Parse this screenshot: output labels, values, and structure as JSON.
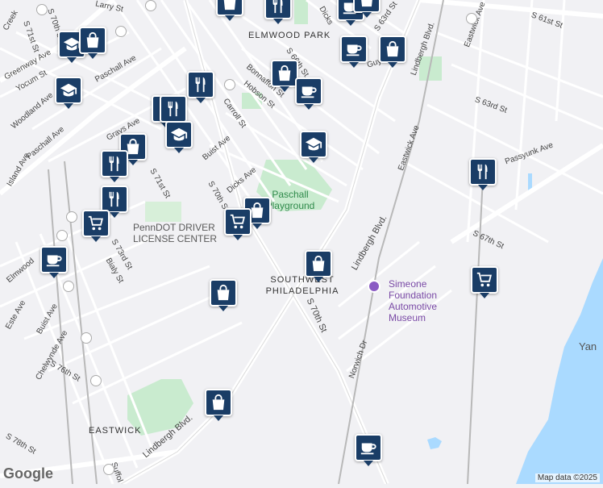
{
  "map": {
    "neighborhoods": [
      "ELMWOOD PARK",
      "SOUTHWEST PHILADELPHIA",
      "EASTWICK"
    ],
    "water_label": "Yan",
    "parks": [
      "Paschall Playground"
    ],
    "pois": [
      "PennDOT DRIVER LICENSE CENTER",
      "Simeone Foundation Automotive Museum"
    ],
    "streets": {
      "larry": "Larry St",
      "s70a": "S 70th St",
      "s71a": "S 71st St",
      "creek": "Creek",
      "greenway": "Greenway Ave",
      "yocum": "Yocum St",
      "paschall1": "Paschall Ave",
      "woodland": "Woodland Ave",
      "paschall2": "Paschall Ave",
      "island": "Island Ave",
      "grays": "Grays Ave",
      "bonnaffon": "Bonnaffon St",
      "hobson": "Hobson St",
      "carroll": "Carroll St",
      "buist1": "Buist Ave",
      "dicks1": "Dicks Ave",
      "s70b": "S 70th St",
      "s71b": "S 71st St",
      "s66": "S 66th St",
      "s63a": "S 63rd St",
      "s61": "S 61st St",
      "eastwick1": "Eastwick Ave",
      "eastwick2": "Eastwick Ave",
      "s63b": "S 63rd St",
      "lindbergh1": "Lindbergh Blvd.",
      "lindbergh2": "Lindbergh Blvd.",
      "lindbergh3": "Lindbergh Blvd.",
      "passyunk": "Passyunk Ave",
      "s67": "S 67th St",
      "s73": "S 73rd St",
      "bialy": "Bialy St",
      "elmwood": "Elmwood",
      "este": "Este Ave",
      "buist2": "Buist Ave",
      "chelwynde": "Chelwynde Ave",
      "s76": "S 76th St",
      "s70c": "S 70th St",
      "norwich": "Norwich Dr",
      "s78": "S 78th St",
      "suffolk": "Suffol",
      "guyer": "Guye",
      "dicks2": "Dicks"
    },
    "markers": [
      {
        "icon": "coffee-icon"
      },
      {
        "icon": "shopping-bag-icon"
      },
      {
        "icon": "restaurant-icon"
      },
      {
        "icon": "shopping-bag-icon"
      },
      {
        "icon": "coffee-icon"
      },
      {
        "icon": "shopping-bag-icon"
      },
      {
        "icon": "school-icon"
      },
      {
        "icon": "shopping-bag-icon"
      },
      {
        "icon": "school-icon"
      },
      {
        "icon": "restaurant-icon"
      },
      {
        "icon": "restaurant-icon"
      },
      {
        "icon": "shopping-bag-icon"
      },
      {
        "icon": "coffee-icon"
      },
      {
        "icon": "school-icon"
      },
      {
        "icon": "restaurant-icon"
      },
      {
        "icon": "shopping-bag-icon"
      },
      {
        "icon": "school-icon"
      },
      {
        "icon": "restaurant-icon"
      },
      {
        "icon": "restaurant-icon"
      },
      {
        "icon": "shopping-cart-icon"
      },
      {
        "icon": "shopping-bag-icon"
      },
      {
        "icon": "shopping-cart-icon"
      },
      {
        "icon": "shopping-bag-icon"
      },
      {
        "icon": "restaurant-icon"
      },
      {
        "icon": "coffee-icon"
      },
      {
        "icon": "shopping-bag-icon"
      },
      {
        "icon": "shopping-cart-icon"
      },
      {
        "icon": "shopping-bag-icon"
      },
      {
        "icon": "coffee-icon"
      }
    ],
    "logo": "Google",
    "attribution": "Map data ©2025"
  }
}
